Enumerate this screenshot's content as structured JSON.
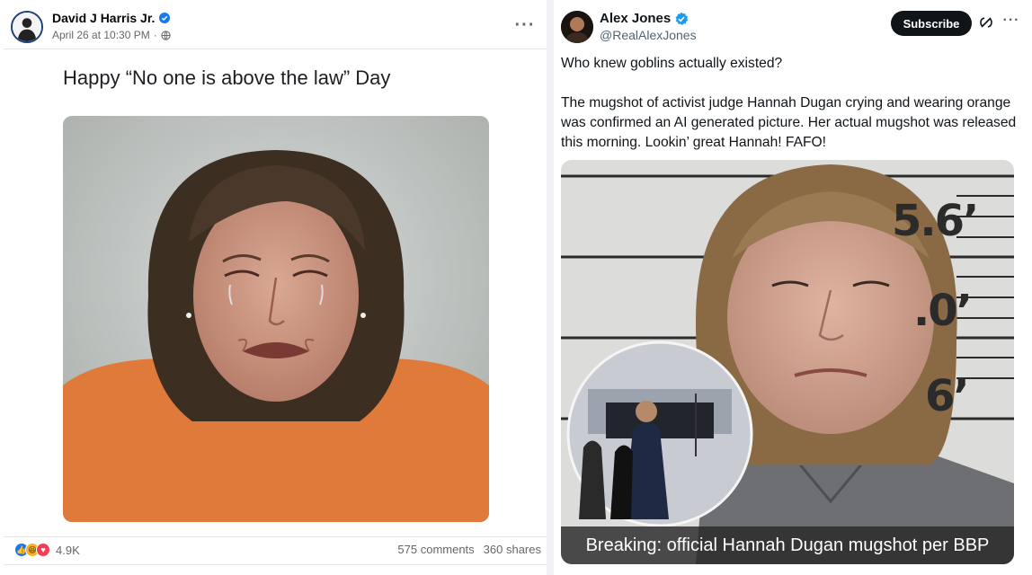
{
  "facebook": {
    "author": "David J Harris Jr.",
    "timestamp": "April 26 at 10:30 PM",
    "post_text": "Happy “No one is above the law” Day",
    "reaction_count": "4.9K",
    "comments": "575 comments",
    "shares": "360 shares",
    "colors": {
      "like": "#1877f2",
      "haha": "#f7b125",
      "love": "#f33e58",
      "verified": "#1877f2"
    }
  },
  "x": {
    "author": "Alex Jones",
    "handle": "@RealAlexJones",
    "subscribe_label": "Subscribe",
    "paragraphs": [
      "Who knew goblins actually existed?",
      "The mugshot of activist judge Hannah Dugan crying and wearing orange was confirmed an AI generated picture. Her actual mugshot was released this morning. Lookin’ great Hannah! FAFO!"
    ],
    "image_caption": "Breaking: official Hannah Dugan mugshot per BBP",
    "ruler_marks": [
      "5.6’",
      ".0’",
      "6’"
    ],
    "colors": {
      "verified": "#1d9bf0",
      "subscribe_bg": "#0f1419"
    }
  }
}
